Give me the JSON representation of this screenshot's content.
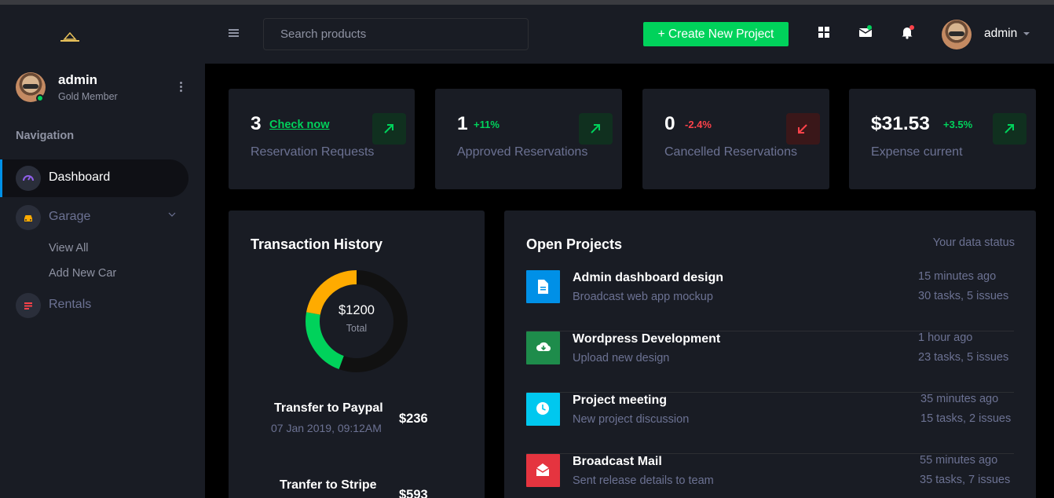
{
  "sidebar": {
    "profile": {
      "name": "admin",
      "role": "Gold Member"
    },
    "nav_heading": "Navigation",
    "items": [
      {
        "label": "Dashboard",
        "icon": "speedometer-icon",
        "color": "#8f5fe8"
      },
      {
        "label": "Garage",
        "icon": "car-icon",
        "color": "#ffab00"
      },
      {
        "label": "View All"
      },
      {
        "label": "Add New Car"
      },
      {
        "label": "Rentals",
        "icon": "list-icon",
        "color": "#fc424a"
      }
    ]
  },
  "header": {
    "search_placeholder": "Search products",
    "create_label": "+ Create New Project",
    "user_name": "admin"
  },
  "stats": [
    {
      "value": "3",
      "link": "Check now",
      "label": "Reservation Requests",
      "trend": "up"
    },
    {
      "value": "1",
      "change": "+11%",
      "label": "Approved Reservations",
      "trend": "up"
    },
    {
      "value": "0",
      "change": "-2.4%",
      "label": "Cancelled Reservations",
      "trend": "down"
    },
    {
      "value": "$31.53",
      "change": "+3.5%",
      "label": "Expense current",
      "trend": "up"
    }
  ],
  "transactions": {
    "title": "Transaction History",
    "donut": {
      "amount": "$1200",
      "label": "Total",
      "segments": [
        {
          "value": 50,
          "color": "#111111"
        },
        {
          "value": 20,
          "color": "#00d25b"
        },
        {
          "value": 20,
          "color": "#ffab00"
        }
      ]
    },
    "items": [
      {
        "title": "Transfer to Paypal",
        "date": "07 Jan 2019, 09:12AM",
        "amount": "$236"
      },
      {
        "title": "Tranfer to Stripe",
        "amount": "$593"
      }
    ]
  },
  "projects": {
    "title": "Open Projects",
    "status": "Your data status",
    "items": [
      {
        "title": "Admin dashboard design",
        "subtitle": "Broadcast web app mockup",
        "time": "15 minutes ago",
        "meta": "30 tasks, 5 issues",
        "icon": "document-icon",
        "color": "#0090e7"
      },
      {
        "title": "Wordpress Development",
        "subtitle": "Upload new design",
        "time": "1 hour ago",
        "meta": "23 tasks, 5 issues",
        "icon": "cloud-download-icon",
        "color": "#1e8c4b"
      },
      {
        "title": "Project meeting",
        "subtitle": "New project discussion",
        "time": "35 minutes ago",
        "meta": "15 tasks, 2 issues",
        "icon": "clock-icon",
        "color": "#00c8ef"
      },
      {
        "title": "Broadcast Mail",
        "subtitle": "Sent release details to team",
        "time": "55 minutes ago",
        "meta": "35 tasks, 7 issues",
        "icon": "email-open-icon",
        "color": "#fc424a"
      }
    ]
  }
}
